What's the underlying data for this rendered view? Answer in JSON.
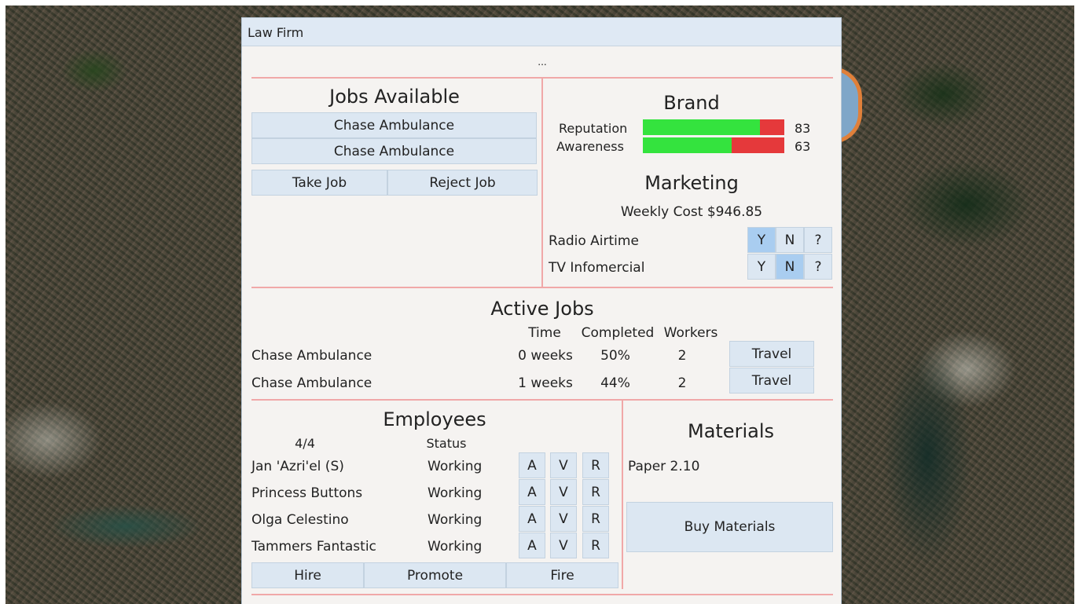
{
  "window": {
    "title": "Law Firm",
    "subtitle": "..."
  },
  "jobs_available": {
    "heading": "Jobs Available",
    "items": [
      "Chase Ambulance",
      "Chase Ambulance"
    ],
    "take_label": "Take Job",
    "reject_label": "Reject Job"
  },
  "brand": {
    "heading": "Brand",
    "reputation": {
      "label": "Reputation",
      "value": "83",
      "fraction": 0.83
    },
    "awareness": {
      "label": "Awareness",
      "value": "63",
      "fraction": 0.63
    },
    "good_color": "#34e33e",
    "bad_color": "#e5393b"
  },
  "marketing": {
    "heading": "Marketing",
    "weekly_cost": "Weekly Cost $946.85",
    "options": [
      {
        "label": "Radio Airtime",
        "y": "Y",
        "n": "N",
        "q": "?",
        "selected": "Y"
      },
      {
        "label": "TV Infomercial",
        "y": "Y",
        "n": "N",
        "q": "?",
        "selected": "N"
      }
    ]
  },
  "active_jobs": {
    "heading": "Active Jobs",
    "columns": {
      "time": "Time",
      "completed": "Completed",
      "workers": "Workers"
    },
    "rows": [
      {
        "name": "Chase Ambulance",
        "time": "0 weeks",
        "completed": "50%",
        "workers": "2",
        "action": "Travel"
      },
      {
        "name": "Chase Ambulance",
        "time": "1 weeks",
        "completed": "44%",
        "workers": "2",
        "action": "Travel"
      }
    ]
  },
  "employees": {
    "heading": "Employees",
    "count": "4/4",
    "status_header": "Status",
    "rows": [
      {
        "name": "Jan 'Azri'el (S)",
        "status": "Working",
        "a": "A",
        "v": "V",
        "r": "R"
      },
      {
        "name": "Princess Buttons",
        "status": "Working",
        "a": "A",
        "v": "V",
        "r": "R"
      },
      {
        "name": "Olga Celestino",
        "status": "Working",
        "a": "A",
        "v": "V",
        "r": "R"
      },
      {
        "name": "Tammers Fantastic",
        "status": "Working",
        "a": "A",
        "v": "V",
        "r": "R"
      }
    ],
    "hire_label": "Hire",
    "promote_label": "Promote",
    "fire_label": "Fire"
  },
  "materials": {
    "heading": "Materials",
    "paper": "Paper 2.10",
    "buy_label": "Buy Materials"
  },
  "colors": {
    "selected": "#a9cdf0",
    "button": "#dce7f2",
    "divider": "#f0a8a8"
  }
}
